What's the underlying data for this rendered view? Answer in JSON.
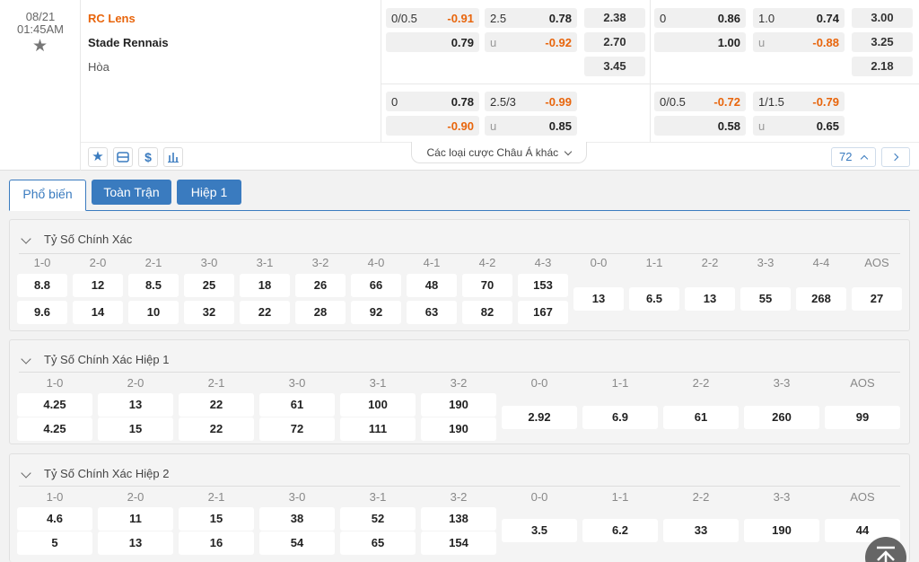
{
  "match": {
    "date": "08/21",
    "time": "01:45AM",
    "home": "RC Lens",
    "away": "Stade Rennais",
    "draw": "Hòa"
  },
  "odds_row1": {
    "ah_line": "0/0.5",
    "ah_home": "-0.91",
    "ah_away": "0.79",
    "ou_line": "2.5",
    "ou_over": "0.78",
    "ou_u": "u",
    "ou_under": "-0.92",
    "x12_home": "2.38",
    "x12_away": "2.70",
    "x12_draw": "3.45",
    "h1_ah_line": "0",
    "h1_ah_home": "0.86",
    "h1_ah_away": "1.00",
    "h1_ou_line": "1.0",
    "h1_ou_over": "0.74",
    "h1_ou_u": "u",
    "h1_ou_under": "-0.88",
    "h1_x12_home": "3.00",
    "h1_x12_away": "3.25",
    "h1_x12_draw": "2.18"
  },
  "odds_row2": {
    "ah_line": "0",
    "ah_home": "0.78",
    "ah_away": "-0.90",
    "ou_line": "2.5/3",
    "ou_over": "-0.99",
    "ou_u": "u",
    "ou_under": "0.85",
    "h1_ah_line": "0/0.5",
    "h1_ah_home": "-0.72",
    "h1_ah_away": "0.58",
    "h1_ou_line": "1/1.5",
    "h1_ou_over": "-0.79",
    "h1_ou_u": "u",
    "h1_ou_under": "0.65"
  },
  "toolbar": {
    "more_asian": "Các loại cược Châu Á khác",
    "count": "72"
  },
  "tabs": [
    "Phổ biến",
    "Toàn Trận",
    "Hiệp 1"
  ],
  "panel1": {
    "title": "Tỷ Số Chính Xác",
    "win_headers": [
      "1-0",
      "2-0",
      "2-1",
      "3-0",
      "3-1",
      "3-2",
      "4-0",
      "4-1",
      "4-2",
      "4-3"
    ],
    "home_odds": [
      "8.8",
      "12",
      "8.5",
      "25",
      "18",
      "26",
      "66",
      "48",
      "70",
      "153"
    ],
    "away_odds": [
      "9.6",
      "14",
      "10",
      "32",
      "22",
      "28",
      "92",
      "63",
      "82",
      "167"
    ],
    "draw_headers": [
      "0-0",
      "1-1",
      "2-2",
      "3-3",
      "4-4",
      "AOS"
    ],
    "draw_odds": [
      "13",
      "6.5",
      "13",
      "55",
      "268",
      "27"
    ]
  },
  "panel2": {
    "title": "Tỷ Số Chính Xác Hiệp 1",
    "win_headers": [
      "1-0",
      "2-0",
      "2-1",
      "3-0",
      "3-1",
      "3-2"
    ],
    "home_odds": [
      "4.25",
      "13",
      "22",
      "61",
      "100",
      "190"
    ],
    "away_odds": [
      "4.25",
      "15",
      "22",
      "72",
      "111",
      "190"
    ],
    "draw_headers": [
      "0-0",
      "1-1",
      "2-2",
      "3-3",
      "AOS"
    ],
    "draw_odds": [
      "2.92",
      "6.9",
      "61",
      "260",
      "99"
    ]
  },
  "panel3": {
    "title": "Tỷ Số Chính Xác Hiệp 2",
    "win_headers": [
      "1-0",
      "2-0",
      "2-1",
      "3-0",
      "3-1",
      "3-2"
    ],
    "home_odds": [
      "4.6",
      "11",
      "15",
      "38",
      "52",
      "138"
    ],
    "away_odds": [
      "5",
      "13",
      "16",
      "54",
      "65",
      "154"
    ],
    "draw_headers": [
      "0-0",
      "1-1",
      "2-2",
      "3-3",
      "AOS"
    ],
    "draw_odds": [
      "3.5",
      "6.2",
      "33",
      "190",
      "44"
    ]
  },
  "colors": {
    "accent": "#3a7bbf",
    "negative": "#e8650c",
    "home_team": "#e8650c"
  }
}
